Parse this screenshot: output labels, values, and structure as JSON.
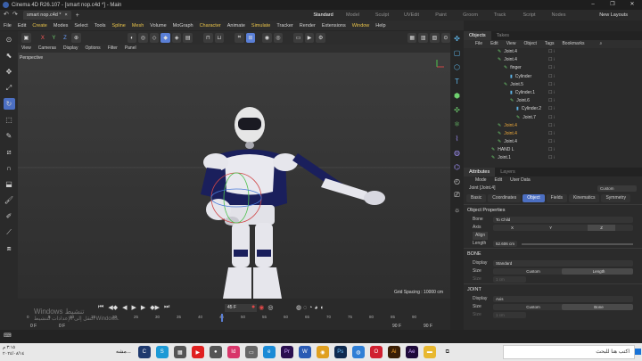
{
  "window": {
    "title": "Cinema 4D R26.107 - [smart nop.c4d *] - Main",
    "min": "–",
    "max": "❐",
    "close": "✕"
  },
  "doc_tab": {
    "name": "smart nop.c4d *",
    "close": "×",
    "add": "+"
  },
  "layouts": [
    "Standard",
    "Model",
    "Sculpt",
    "UVEdit",
    "Paint",
    "Groom",
    "Track",
    "Script",
    "Nodes"
  ],
  "new_layouts": "New Layouts",
  "menu": [
    "File",
    "Edit",
    "Create",
    "Modes",
    "Select",
    "Tools",
    "Spline",
    "Mesh",
    "Volume",
    "MoGraph",
    "Character",
    "Animate",
    "Simulate",
    "Tracker",
    "Render",
    "Extensions",
    "Window",
    "Help"
  ],
  "toolbar_axes": [
    "X",
    "Y",
    "Z"
  ],
  "viewport": {
    "menu": [
      "View",
      "Cameras",
      "Display",
      "Options",
      "Filter",
      "Panel"
    ],
    "label": "Perspective",
    "grid": "Grid Spacing : 10000 cm"
  },
  "objects_panel": {
    "tabs": [
      "Objects",
      "Takes"
    ],
    "menu": [
      "File",
      "Edit",
      "View",
      "Object",
      "Tags",
      "Bookmarks"
    ],
    "rows": [
      {
        "name": "Joint.4",
        "indent": 0,
        "icon": "joint"
      },
      {
        "name": "Joint.4",
        "indent": 0,
        "icon": "joint"
      },
      {
        "name": "finger",
        "indent": 1,
        "icon": "joint"
      },
      {
        "name": "Cylinder",
        "indent": 2,
        "icon": "cylinder"
      },
      {
        "name": "Joint.5",
        "indent": 1,
        "icon": "joint"
      },
      {
        "name": "Cylinder.1",
        "indent": 2,
        "icon": "cylinder"
      },
      {
        "name": "Joint.6",
        "indent": 2,
        "icon": "joint"
      },
      {
        "name": "Cylinder.2",
        "indent": 3,
        "icon": "cylinder"
      },
      {
        "name": "Joint.7",
        "indent": 3,
        "icon": "joint"
      },
      {
        "name": "Joint.4",
        "indent": 0,
        "icon": "joint",
        "selected": true
      },
      {
        "name": "Joint.4",
        "indent": 0,
        "icon": "joint",
        "selected": true
      },
      {
        "name": "Joint.4",
        "indent": 0,
        "icon": "joint"
      },
      {
        "name": "HAND L",
        "indent": -1,
        "icon": "joint"
      },
      {
        "name": "Joint.1",
        "indent": -1,
        "icon": "joint"
      }
    ]
  },
  "attributes_panel": {
    "tabs": [
      "Attributes",
      "Layers"
    ],
    "menu": [
      "Mode",
      "Edit",
      "User Data"
    ],
    "object_name": "Joint [Joint.4]",
    "custom": "Custom",
    "subtabs": [
      "Basic",
      "Coordinates",
      "Object",
      "Fields",
      "Kinematics",
      "Symmetry"
    ],
    "active_subtab": "Object",
    "sections": {
      "object_properties": "Object Properties",
      "bone": "BONE",
      "joint": "JOINT"
    },
    "props": {
      "bone_label": "Bone",
      "bone_value": "To Child",
      "axis_label": "Axis",
      "axis_x": "X",
      "axis_y": "Y",
      "axis_z": "Z",
      "align_label": "Align",
      "length_label": "Length",
      "length_value": "52.606 cm",
      "bone_display_label": "Display",
      "bone_display_value": "Standard",
      "bone_size_label": "Size",
      "bone_size_value": "Custom",
      "bone_size_mode": "Length",
      "bone_size_dim_label": "Size",
      "bone_size_dim_value": "1 cm",
      "joint_display_label": "Display",
      "joint_display_value": "Axis",
      "joint_size_label": "Size",
      "joint_size_value": "Custom",
      "joint_size_mode": "Bone",
      "joint_size_dim_label": "Size",
      "joint_size_dim_value": "1 cm"
    }
  },
  "timeline": {
    "current_frame": "45 F",
    "ticks": [
      "0",
      "5",
      "10",
      "15",
      "20",
      "25",
      "30",
      "35",
      "40",
      "45",
      "50",
      "55",
      "60",
      "65",
      "70",
      "75",
      "80",
      "85",
      "90"
    ],
    "start": "0 F",
    "start2": "0 F",
    "end": "90 F",
    "end2": "90 F"
  },
  "watermark": {
    "line1": "Windows تنشيط",
    "line2": "انتقل إلى الإعدادات لتنشيط Windows."
  },
  "taskbar": {
    "search_placeholder": "اكتب هنا للبحث",
    "date": "٢٠٢٤/٠٨/١٤",
    "time": "٣:١٥ م",
    "app_label": "مشه..."
  }
}
